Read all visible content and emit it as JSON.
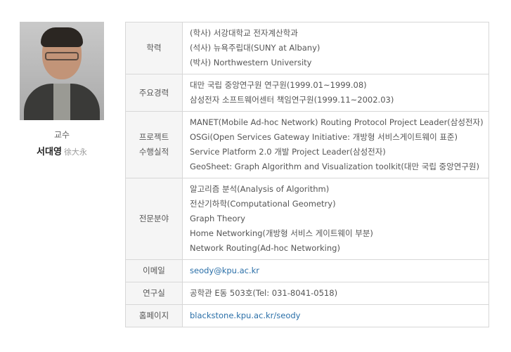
{
  "profile": {
    "role": "교수",
    "name": "서대영",
    "hanja": "徐大永"
  },
  "rows": [
    {
      "label": "학력",
      "lines": [
        "(학사) 서강대학교 전자계산학과",
        "(석사) 뉴욕주립대(SUNY at Albany)",
        "(박사) Northwestern University"
      ]
    },
    {
      "label": "주요경력",
      "lines": [
        "대만 국립 중앙연구원 연구원(1999.01~1999.08)",
        "삼성전자 소프트웨어센터 책임연구원(1999.11~2002.03)"
      ]
    },
    {
      "label_lines": [
        "프로젝트",
        "수행실적"
      ],
      "lines": [
        "MANET(Mobile Ad-hoc Network) Routing Protocol Project Leader(삼성전자)",
        "OSGi(Open Services Gateway Initiative: 개방형 서비스게이트웨이 표준)",
        "Service Platform 2.0 개발 Project Leader(삼성전자)",
        "GeoSheet: Graph Algorithm and Visualization toolkit(대만 국립 중앙연구원)"
      ]
    },
    {
      "label": "전문분야",
      "lines": [
        "알고리즘 분석(Analysis of Algorithm)",
        "전산기하학(Computational Geometry)",
        "Graph Theory",
        "Home Networking(개방형 서비스 게이트웨이 부분)",
        "Network Routing(Ad-hoc Networking)"
      ]
    },
    {
      "label": "이메일",
      "value": "seody@kpu.ac.kr"
    },
    {
      "label": "연구실",
      "value": "공학관 E동 503호(Tel: 031-8041-0518)"
    },
    {
      "label": "홈페이지",
      "value": "blackstone.kpu.ac.kr/seody"
    }
  ]
}
